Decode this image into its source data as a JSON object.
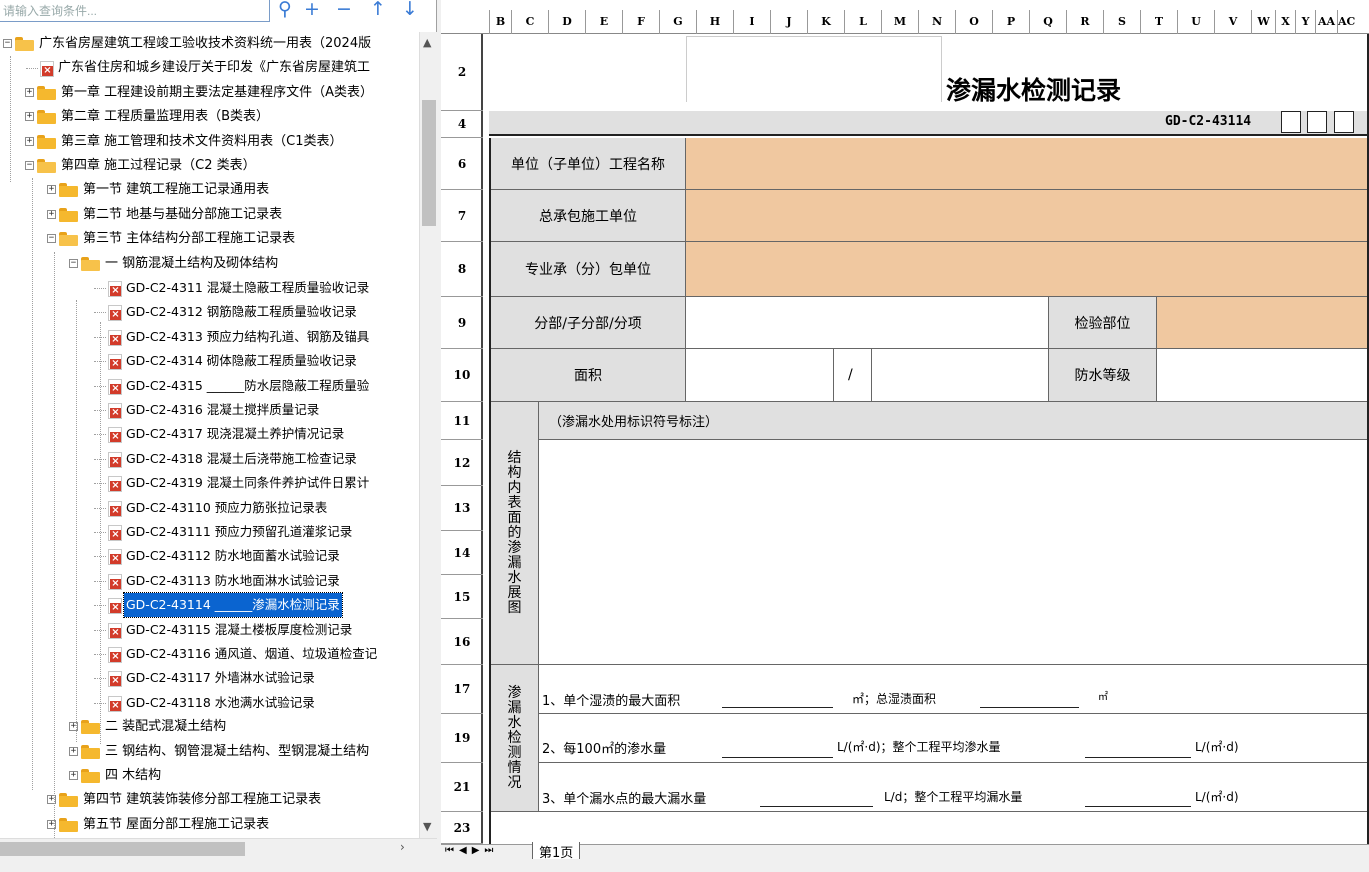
{
  "search": {
    "placeholder": "请输入查询条件...",
    "value": ""
  },
  "toolbar": {
    "search_icon": "search-icon",
    "expand": "+",
    "collapse": "−",
    "up": "↑",
    "down": "↓"
  },
  "tree": [
    {
      "label": "广东省房屋建筑工程竣工验收技术资料统一用表（2024版",
      "level": 0,
      "type": "folder",
      "open": true
    },
    {
      "label": "广东省住房和城乡建设厅关于印发《广东省房屋建筑工",
      "level": 1,
      "type": "pdf"
    },
    {
      "label": "第一章 工程建设前期主要法定基建程序文件（A类表）",
      "level": 1,
      "type": "folder"
    },
    {
      "label": "第二章 工程质量监理用表（B类表）",
      "level": 1,
      "type": "folder"
    },
    {
      "label": "第三章 施工管理和技术文件资料用表（C1类表）",
      "level": 1,
      "type": "folder"
    },
    {
      "label": "第四章 施工过程记录（C2 类表）",
      "level": 1,
      "type": "folder",
      "open": true
    },
    {
      "label": "第一节 建筑工程施工记录通用表",
      "level": 2,
      "type": "folder"
    },
    {
      "label": "第二节 地基与基础分部施工记录表",
      "level": 2,
      "type": "folder"
    },
    {
      "label": "第三节 主体结构分部工程施工记录表",
      "level": 2,
      "type": "folder",
      "open": true
    },
    {
      "label": "一 钢筋混凝土结构及砌体结构",
      "level": 3,
      "type": "folder",
      "open": true
    },
    {
      "label": "GD-C2-4311 混凝土隐蔽工程质量验收记录",
      "level": 4,
      "type": "pdf"
    },
    {
      "label": "GD-C2-4312 钢筋隐蔽工程质量验收记录",
      "level": 4,
      "type": "pdf"
    },
    {
      "label": "GD-C2-4313 预应力结构孔道、钢筋及锚具",
      "level": 4,
      "type": "pdf"
    },
    {
      "label": "GD-C2-4314 砌体隐蔽工程质量验收记录",
      "level": 4,
      "type": "pdf"
    },
    {
      "label": "GD-C2-4315 ______防水层隐蔽工程质量验",
      "level": 4,
      "type": "pdf"
    },
    {
      "label": "GD-C2-4316 混凝土搅拌质量记录",
      "level": 4,
      "type": "pdf"
    },
    {
      "label": "GD-C2-4317 现浇混凝土养护情况记录",
      "level": 4,
      "type": "pdf"
    },
    {
      "label": "GD-C2-4318 混凝土后浇带施工检查记录",
      "level": 4,
      "type": "pdf"
    },
    {
      "label": "GD-C2-4319 混凝土同条件养护试件日累计",
      "level": 4,
      "type": "pdf"
    },
    {
      "label": "GD-C2-43110 预应力筋张拉记录表",
      "level": 4,
      "type": "pdf"
    },
    {
      "label": "GD-C2-43111 预应力预留孔道灌浆记录",
      "level": 4,
      "type": "pdf"
    },
    {
      "label": "GD-C2-43112 防水地面蓄水试验记录",
      "level": 4,
      "type": "pdf"
    },
    {
      "label": "GD-C2-43113 防水地面淋水试验记录",
      "level": 4,
      "type": "pdf"
    },
    {
      "label": "GD-C2-43114 ______渗漏水检测记录",
      "level": 4,
      "type": "pdf",
      "selected": true
    },
    {
      "label": "GD-C2-43115 混凝土楼板厚度检测记录",
      "level": 4,
      "type": "pdf"
    },
    {
      "label": "GD-C2-43116 通风道、烟道、垃圾道检查记",
      "level": 4,
      "type": "pdf"
    },
    {
      "label": "GD-C2-43117 外墙淋水试验记录",
      "level": 4,
      "type": "pdf"
    },
    {
      "label": "GD-C2-43118 水池满水试验记录",
      "level": 4,
      "type": "pdf"
    },
    {
      "label": "二 装配式混凝土结构",
      "level": 3,
      "type": "folder"
    },
    {
      "label": "三 钢结构、钢管混凝土结构、型钢混凝土结构",
      "level": 3,
      "type": "folder"
    },
    {
      "label": "四 木结构",
      "level": 3,
      "type": "folder"
    },
    {
      "label": "第四节 建筑装饰装修分部工程施工记录表",
      "level": 2,
      "type": "folder"
    },
    {
      "label": "第五节 屋面分部工程施工记录表",
      "level": 2,
      "type": "folder"
    }
  ],
  "sheet": {
    "columns": [
      "B",
      "C",
      "D",
      "E",
      "F",
      "G",
      "H",
      "I",
      "J",
      "K",
      "L",
      "M",
      "N",
      "O",
      "P",
      "Q",
      "R",
      "S",
      "T",
      "U",
      "V",
      "W",
      "X",
      "Y",
      "AA",
      "AC"
    ],
    "rows": [
      "2",
      "4",
      "6",
      "7",
      "8",
      "9",
      "10",
      "11",
      "12",
      "13",
      "14",
      "15",
      "16",
      "17",
      "19",
      "21",
      "23"
    ],
    "title": "渗漏水检测记录",
    "code": "GD-C2-43114",
    "project_name_label": "单位（子单位）工程名称",
    "contractor_label": "总承包施工单位",
    "subcontractor_label": "专业承（分）包单位",
    "division_label": "分部/子分部/分项",
    "inspect_location_label": "检验部位",
    "area_label": "面积",
    "slash": "/",
    "waterproof_grade_label": "防水等级",
    "structure_label": "结构内表面的渗漏水展图",
    "mark_note": "（渗漏水处用标识符号标注）",
    "leak_label": "渗漏水检测情况",
    "item1_label": "1、单个湿渍的最大面积",
    "item1_unit1": "㎡；总湿渍面积",
    "item1_unit2": "㎡",
    "item2_label": "2、每100㎡的渗水量",
    "item2_unit1": "L/(㎡·d)；整个工程平均渗水量",
    "item2_unit2": "L/(㎡·d)",
    "item3_label": "3、单个漏水点的最大漏水量",
    "item3_unit1": "L/d；整个工程平均漏水量",
    "item3_unit2": "L/(㎡·d)"
  },
  "sheet_tabs": {
    "active": "第1页"
  },
  "colors": {
    "orange": "#f0c8a0",
    "gray": "#e0e0e0",
    "selection": "#0a64d0"
  }
}
